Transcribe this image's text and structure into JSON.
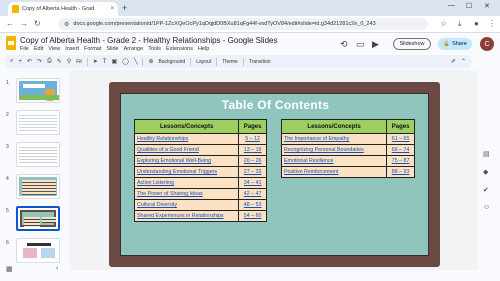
{
  "browser": {
    "tab_title": "Copy of Alberta Health - Grad",
    "tab_close": "×",
    "new_tab": "+",
    "window_controls": [
      "—",
      "☐",
      "✕"
    ],
    "url": "docs.google.com/presentation/d/1PP-1ZcXQeOcPy1qDqjdD0BXu81qFg44f-vsdTyOV84/edit#slide=id.g34d21281c2e_0_243"
  },
  "docs": {
    "title": "Copy of Alberta Health - Grade 2 - Healthy Relationships - Google Slides",
    "menu": [
      "File",
      "Edit",
      "View",
      "Insert",
      "Format",
      "Slide",
      "Arrange",
      "Tools",
      "Extensions",
      "Help"
    ],
    "slideshow_label": "Slideshow",
    "share_label": "Share",
    "avatar_initial": "C"
  },
  "toolbar": {
    "zoom_label": "Fit",
    "background_label": "Background",
    "layout_label": "Layout",
    "theme_label": "Theme",
    "transition_label": "Transition"
  },
  "filmstrip": {
    "numbers": [
      "1",
      "2",
      "3",
      "4",
      "5",
      "6"
    ],
    "selected_index": 4
  },
  "slide": {
    "title": "Table Of Contents",
    "left_table": {
      "headers": [
        "Lessons/Concepts",
        "Pages"
      ],
      "rows": [
        [
          "Healthy Relationships",
          "5 – 12"
        ],
        [
          "Qualities of a Good Friend",
          "13 – 19"
        ],
        [
          "Exploring Emotional Well-Being",
          "20 – 26"
        ],
        [
          "Understanding Emotional Triggers",
          "27 – 33"
        ],
        [
          "Active Listening",
          "34 – 41"
        ],
        [
          "The Power of Sharing Ideas",
          "42 – 47"
        ],
        [
          "Cultural Diversity",
          "48 – 53"
        ],
        [
          "Shared Experiences in Relationships",
          "54 – 60"
        ]
      ]
    },
    "right_table": {
      "headers": [
        "Lessons/Concepts",
        "Pages"
      ],
      "rows": [
        [
          "The Importance of Empathy",
          "61 – 65"
        ],
        [
          "Recognizing Personal Boundaries",
          "66 – 74"
        ],
        [
          "Emotional Resilience",
          "75 – 87"
        ],
        [
          "Positive Reinforcement",
          "88 – 93"
        ]
      ]
    }
  },
  "colors": {
    "slide_frame": "#6b4a44",
    "slide_bg": "#8fc5bc",
    "table_header": "#9ccf5f",
    "table_cell": "#fbe2c4",
    "link": "#1a4fb5"
  }
}
